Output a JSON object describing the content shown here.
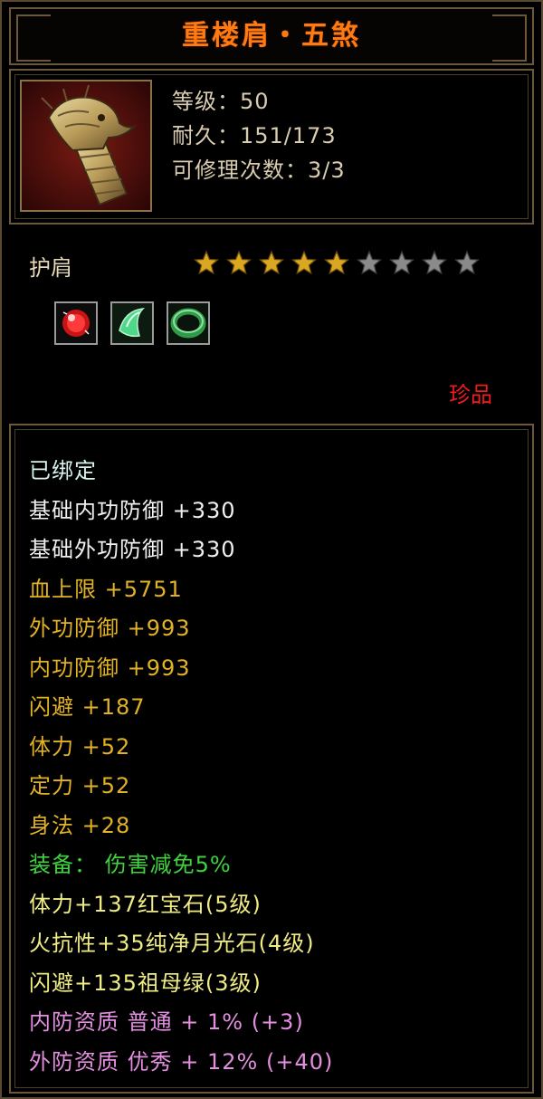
{
  "title": "重楼肩・五煞",
  "item": {
    "image_icon": "dragon-shoulder-armor-icon",
    "level": "等级：50",
    "durability": "耐久：151/173",
    "repairs": "可修理次数：3/3"
  },
  "slot": "护肩",
  "stars": {
    "total": 9,
    "filled": 5
  },
  "gems": [
    {
      "icon": "ruby-gem-icon",
      "color": "#d81a1a"
    },
    {
      "icon": "moonstone-gem-icon",
      "color": "#4fd88a"
    },
    {
      "icon": "emerald-ring-gem-icon",
      "color": "#2f9a4a"
    }
  ],
  "rarity": "珍品",
  "attributes": [
    {
      "text": "已绑定",
      "color": "cyan"
    },
    {
      "text": "基础内功防御 +330",
      "color": "white"
    },
    {
      "text": "基础外功防御 +330",
      "color": "white"
    },
    {
      "text": "血上限 +5751",
      "color": "gold"
    },
    {
      "text": "外功防御 +993",
      "color": "gold"
    },
    {
      "text": "内功防御 +993",
      "color": "gold"
    },
    {
      "text": "闪避 +187",
      "color": "gold"
    },
    {
      "text": "体力 +52",
      "color": "gold"
    },
    {
      "text": "定力 +52",
      "color": "gold"
    },
    {
      "text": "身法 +28",
      "color": "gold"
    },
    {
      "text": "装备： 伤害减免5%",
      "color": "green"
    },
    {
      "text": "体力+137红宝石(5级)",
      "color": "yellow"
    },
    {
      "text": "火抗性+35纯净月光石(4级)",
      "color": "yellow"
    },
    {
      "text": "闪避+135祖母绿(3级)",
      "color": "yellow"
    },
    {
      "text": "内防资质 普通 + 1% (+3)",
      "color": "pink"
    },
    {
      "text": "外防资质 优秀 + 12% (+40)",
      "color": "pink"
    }
  ]
}
